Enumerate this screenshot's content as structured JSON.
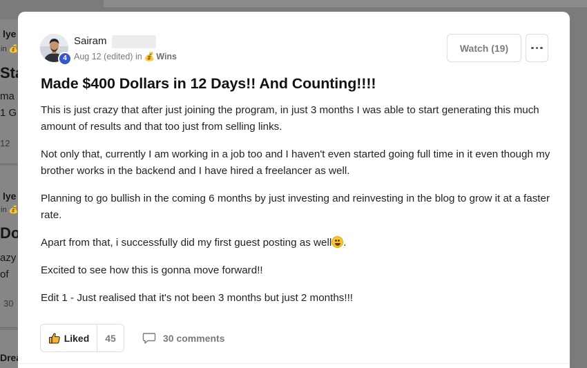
{
  "background_feed": {
    "card1": {
      "name": "lye",
      "line1": "Sta",
      "line2": "ma",
      "line3": "1 G",
      "count": "12"
    },
    "card2": {
      "name": "lye",
      "line1": "Do",
      "line2": "azy",
      "line3": "of",
      "count": "30"
    },
    "card3": {
      "name": "Drea"
    }
  },
  "post": {
    "author": {
      "name": "Sairam",
      "level": "4"
    },
    "meta": {
      "date": "Aug 12 (edited) in",
      "category_icon": "money-bag-icon",
      "category": "Wins"
    },
    "watch_label": "Watch (19)",
    "title": "Made $400 Dollars in 12 Days!! And Counting!!!!",
    "paragraphs": [
      "This is just crazy that after just joining the program, in just 3 months I was able to start generating this much amount of results and that too just from selling links.",
      "Not only that, currently I am working in a job too and I haven't even started going full time in it even though my brother works in the backend and I have hired a freelancer as well.",
      "Planning to go bullish in the coming 6 months by just investing and reinvesting in the blog to grow it at a faster rate.",
      "Apart from that, i successfully did my first guest posting as well",
      "Excited to see how this is gonna move forward!!",
      "Edit 1 - Just realised that it's not been 3 months but just 2 months!!!"
    ],
    "paragraph4_suffix": ".",
    "liked_label": "Liked",
    "like_count": "45",
    "comments_label": "30 comments"
  },
  "colors": {
    "level_badge": "#3a57c8",
    "overlay": "#7b7b7b"
  }
}
